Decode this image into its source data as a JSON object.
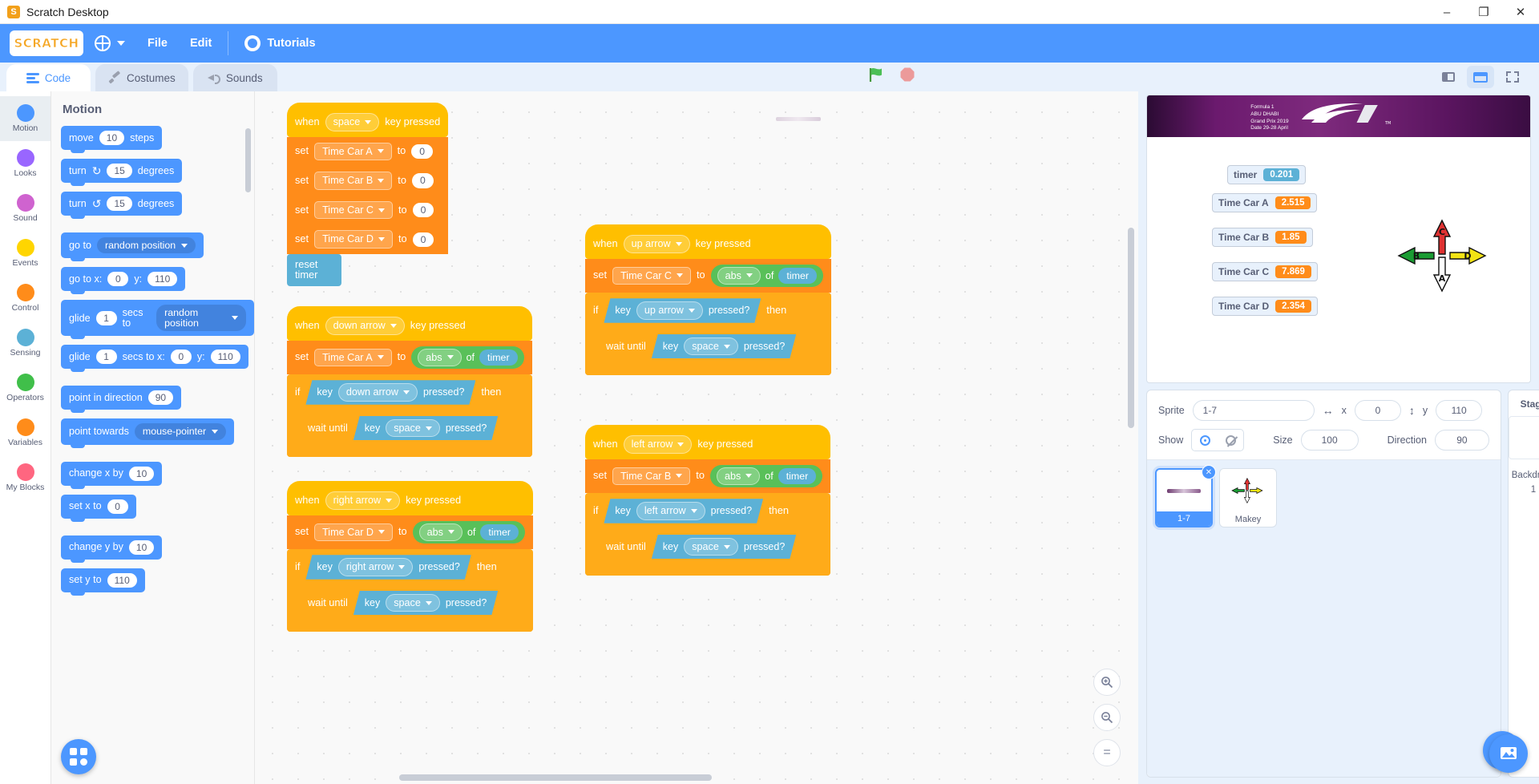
{
  "window": {
    "title": "Scratch Desktop",
    "app_icon": "scratch-app-icon",
    "minimize": "–",
    "maximize": "❐",
    "close": "✕"
  },
  "menubar": {
    "logo_text": "SCRATCH",
    "language_icon": "globe-icon",
    "items": [
      {
        "label": "File",
        "name": "file-menu"
      },
      {
        "label": "Edit",
        "name": "edit-menu"
      }
    ],
    "tutorials": {
      "label": "Tutorials",
      "icon": "lightbulb-icon"
    }
  },
  "tabs": [
    {
      "label": "Code",
      "icon": "code-icon",
      "active": true
    },
    {
      "label": "Costumes",
      "icon": "brush-icon",
      "active": false
    },
    {
      "label": "Sounds",
      "icon": "speaker-icon",
      "active": false
    }
  ],
  "stage_controls": {
    "green_flag": "green-flag-icon",
    "stop": "stop-sign-icon",
    "small_stage": "small-stage-icon",
    "large_stage": "large-stage-icon",
    "fullscreen": "fullscreen-icon"
  },
  "categories": [
    {
      "label": "Motion",
      "color": "#4c97ff",
      "active": true
    },
    {
      "label": "Looks",
      "color": "#9966ff",
      "active": false
    },
    {
      "label": "Sound",
      "color": "#cf63cf",
      "active": false
    },
    {
      "label": "Events",
      "color": "#ffd500",
      "active": false
    },
    {
      "label": "Control",
      "color": "#ff8c1a",
      "active": false
    },
    {
      "label": "Sensing",
      "color": "#5cb1d6",
      "active": false
    },
    {
      "label": "Operators",
      "color": "#40bf4a",
      "active": false
    },
    {
      "label": "Variables",
      "color": "#ff8c1a",
      "active": false
    },
    {
      "label": "My Blocks",
      "color": "#ff6680",
      "active": false
    }
  ],
  "palette": {
    "title": "Motion",
    "blocks": [
      {
        "parts": [
          "move",
          "10",
          "steps"
        ]
      },
      {
        "parts": [
          "turn",
          "↻",
          "15",
          "degrees"
        ]
      },
      {
        "parts": [
          "turn",
          "↺",
          "15",
          "degrees"
        ]
      },
      {
        "parts": [
          "go to",
          "random position"
        ]
      },
      {
        "parts": [
          "go to x:",
          "0",
          "y:",
          "110"
        ]
      },
      {
        "parts": [
          "glide",
          "1",
          "secs to",
          "random position"
        ]
      },
      {
        "parts": [
          "glide",
          "1",
          "secs to x:",
          "0",
          "y:",
          "110"
        ]
      },
      {
        "parts": [
          "point in direction",
          "90"
        ]
      },
      {
        "parts": [
          "point towards",
          "mouse-pointer"
        ]
      },
      {
        "parts": [
          "change x by",
          "10"
        ]
      },
      {
        "parts": [
          "set x to",
          "0"
        ]
      },
      {
        "parts": [
          "change y by",
          "10"
        ]
      },
      {
        "parts": [
          "set y to",
          "110"
        ]
      }
    ],
    "labels": {
      "move": "move",
      "steps": "steps",
      "turn": "turn",
      "degrees": "degrees",
      "go_to": "go to",
      "random_position": "random position",
      "go_to_x": "go to x:",
      "y": "y:",
      "glide": "glide",
      "secs_to": "secs to",
      "secs_to_x": "secs to x:",
      "point_in_direction": "point in direction",
      "point_towards": "point towards",
      "mouse_pointer": "mouse-pointer",
      "change_x_by": "change x by",
      "set_x_to": "set x to",
      "change_y_by": "change y by",
      "set_y_to": "set y to",
      "v10": "10",
      "v15": "15",
      "v0": "0",
      "v110": "110",
      "v1": "1",
      "v90": "90"
    }
  },
  "scripts": [
    {
      "name": "script-space-reset",
      "hat": {
        "when": "when",
        "key": "space",
        "suffix": "key pressed"
      },
      "sets": [
        {
          "label": "set",
          "variable": "Time Car A",
          "to": "to",
          "value": "0"
        },
        {
          "label": "set",
          "variable": "Time Car B",
          "to": "to",
          "value": "0"
        },
        {
          "label": "set",
          "variable": "Time Car C",
          "to": "to",
          "value": "0"
        },
        {
          "label": "set",
          "variable": "Time Car D",
          "to": "to",
          "value": "0"
        }
      ],
      "reset_timer": "reset timer"
    },
    {
      "name": "script-down-arrow",
      "hat": {
        "when": "when",
        "key": "down arrow",
        "suffix": "key pressed"
      },
      "set": {
        "label": "set",
        "variable": "Time Car A",
        "to": "to",
        "operator": "abs",
        "of": "of",
        "operand": "timer"
      },
      "if": {
        "label": "if",
        "key_label": "key",
        "key": "down arrow",
        "pressed": "pressed?",
        "then": "then"
      },
      "wait": {
        "label": "wait until",
        "key_label": "key",
        "key": "space",
        "pressed": "pressed?"
      }
    },
    {
      "name": "script-right-arrow",
      "hat": {
        "when": "when",
        "key": "right arrow",
        "suffix": "key pressed"
      },
      "set": {
        "label": "set",
        "variable": "Time Car D",
        "to": "to",
        "operator": "abs",
        "of": "of",
        "operand": "timer"
      },
      "if": {
        "label": "if",
        "key_label": "key",
        "key": "right arrow",
        "pressed": "pressed?",
        "then": "then"
      },
      "wait": {
        "label": "wait until",
        "key_label": "key",
        "key": "space",
        "pressed": "pressed?"
      }
    },
    {
      "name": "script-up-arrow",
      "hat": {
        "when": "when",
        "key": "up arrow",
        "suffix": "key pressed"
      },
      "set": {
        "label": "set",
        "variable": "Time Car C",
        "to": "to",
        "operator": "abs",
        "of": "of",
        "operand": "timer"
      },
      "if": {
        "label": "if",
        "key_label": "key",
        "key": "up arrow",
        "pressed": "pressed?",
        "then": "then"
      },
      "wait": {
        "label": "wait until",
        "key_label": "key",
        "key": "space",
        "pressed": "pressed?"
      }
    },
    {
      "name": "script-left-arrow",
      "hat": {
        "when": "when",
        "key": "left arrow",
        "suffix": "key pressed"
      },
      "set": {
        "label": "set",
        "variable": "Time Car B",
        "to": "to",
        "operator": "abs",
        "of": "of",
        "operand": "timer"
      },
      "if": {
        "label": "if",
        "key_label": "key",
        "key": "left arrow",
        "pressed": "pressed?",
        "then": "then"
      },
      "wait": {
        "label": "wait until",
        "key_label": "key",
        "key": "space",
        "pressed": "pressed?"
      }
    }
  ],
  "stage": {
    "backdrop_text_line1": "Formula 1",
    "backdrop_text_line2": "ABU DHABI",
    "backdrop_text_line3": "Grand Prix 2019",
    "backdrop_text_line4": "Date 29-28 April",
    "monitors": [
      {
        "label": "timer",
        "value": "0.201",
        "kind": "timer"
      },
      {
        "label": "Time Car A",
        "value": "2.515",
        "kind": "var"
      },
      {
        "label": "Time Car B",
        "value": "1.85",
        "kind": "var"
      },
      {
        "label": "Time Car C",
        "value": "7.869",
        "kind": "var"
      },
      {
        "label": "Time Car D",
        "value": "2.354",
        "kind": "var"
      }
    ],
    "makey_labels": {
      "up": "C",
      "left": "B",
      "right": "D",
      "down": "A"
    }
  },
  "sprite_panel": {
    "sprite_label": "Sprite",
    "sprite_name": "1-7",
    "x_label": "x",
    "x_value": "0",
    "y_label": "y",
    "y_value": "110",
    "show_label": "Show",
    "size_label": "Size",
    "size_value": "100",
    "direction_label": "Direction",
    "direction_value": "90",
    "sprites": [
      {
        "name": "1-7",
        "selected": true
      },
      {
        "name": "Makey",
        "selected": false
      }
    ],
    "add_sprite_icon": "cat-face-icon"
  },
  "stage_column": {
    "title": "Stage",
    "backdrops_label": "Backdrops",
    "backdrops_count": "1",
    "add_backdrop_icon": "backdrop-icon"
  },
  "zoom_controls": {
    "zoom_in": "+",
    "zoom_out": "−",
    "zoom_reset": "="
  },
  "add_extension": {
    "icon": "add-extension-icon"
  },
  "colors": {
    "motion": "#4c97ff",
    "events": "#ffbf00",
    "control": "#ffab19",
    "variables": "#ff8c1a",
    "sensing": "#5cb1d6",
    "operators": "#59c059",
    "menu_blue": "#4c97ff"
  }
}
